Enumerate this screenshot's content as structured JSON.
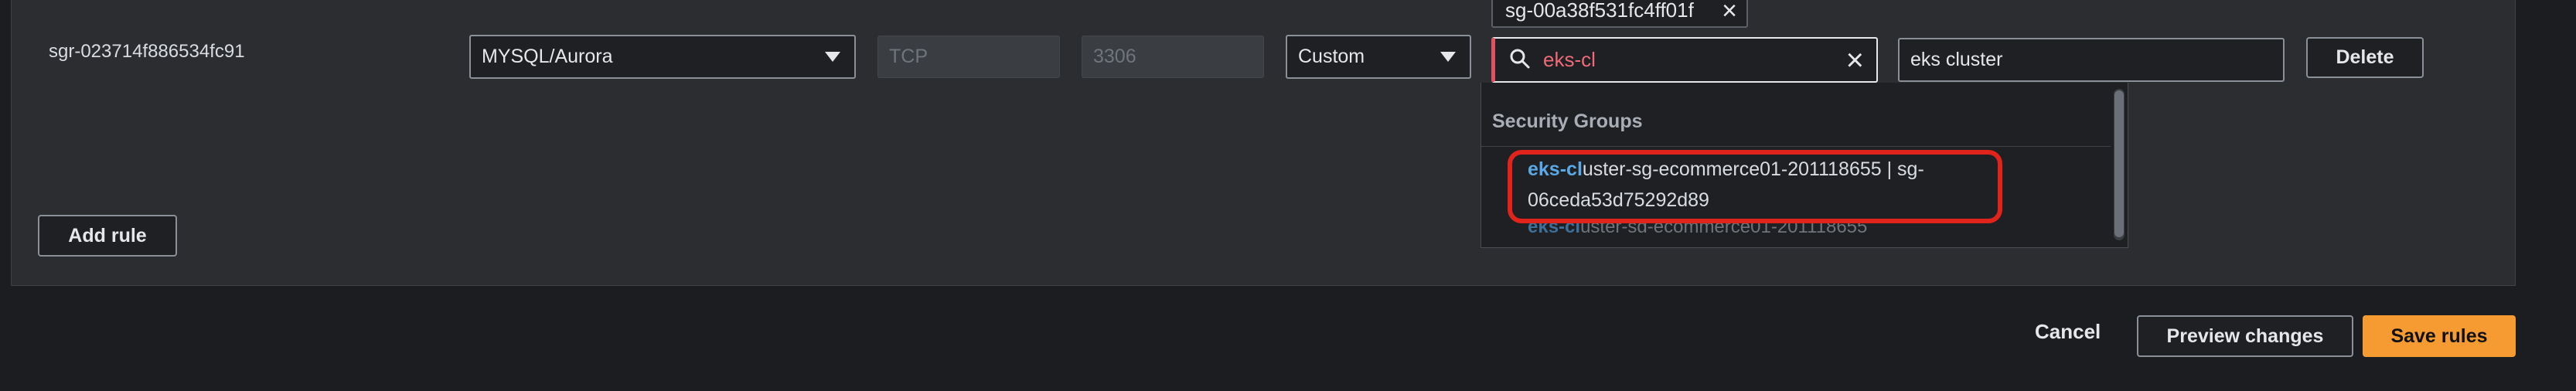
{
  "rule": {
    "id": "sgr-023714f886534fc91",
    "type_value": "MYSQL/Aurora",
    "protocol_value": "TCP",
    "port_value": "3306",
    "source_type_value": "Custom",
    "selected_tag": "sg-00a38f531fc4ff01f",
    "search_value": "eks-cl",
    "description_value": "eks cluster",
    "delete_label": "Delete"
  },
  "dropdown": {
    "header": "Security Groups",
    "option1": {
      "match": "eks-cl",
      "rest": "uster-sg-ecommerce01-201118655 | sg-06ceda53d75292d89"
    },
    "option2": {
      "match": "eks-cl",
      "rest": "uster-sg-ecommerce01-201118655"
    }
  },
  "actions": {
    "add_rule": "Add rule",
    "cancel": "Cancel",
    "preview": "Preview changes",
    "save": "Save rules"
  },
  "colors": {
    "accent": "#f59b31",
    "highlight_box": "#e0231b",
    "match_text": "#5aa9e6",
    "error_border": "#e05262"
  }
}
